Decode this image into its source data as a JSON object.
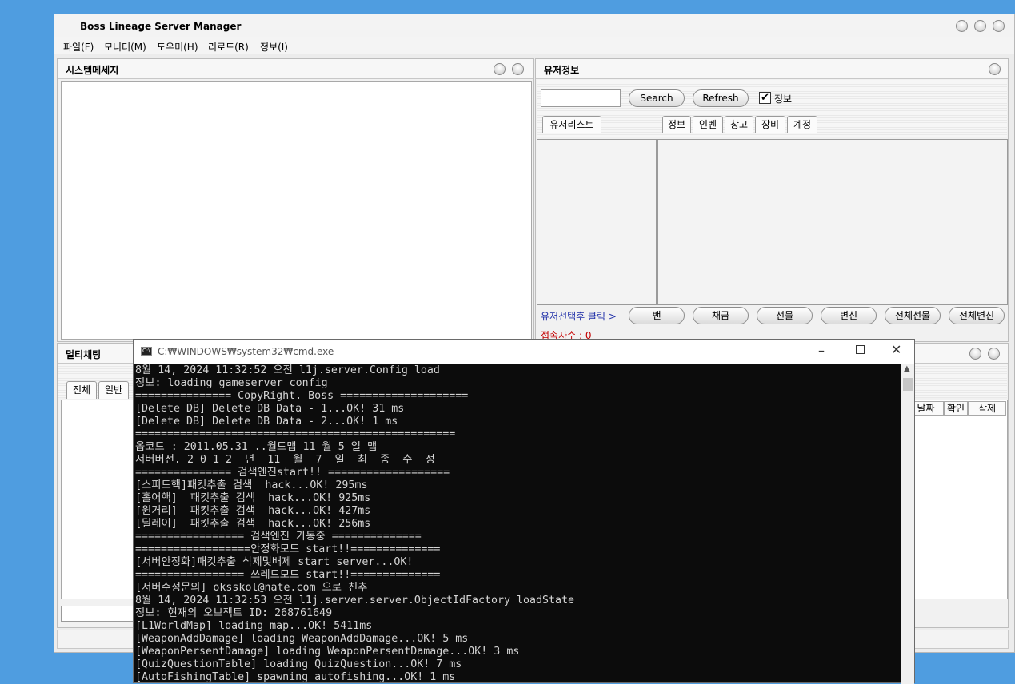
{
  "app": {
    "title": "Boss Lineage Server Manager",
    "menu": [
      "파일(F)",
      "모니터(M)",
      "도우미(H)",
      "리로드(R)",
      "정보(I)"
    ]
  },
  "system_panel": {
    "title": "시스템메세지"
  },
  "user_panel": {
    "title": "유저정보",
    "search_value": "",
    "search_label": "Search",
    "refresh_label": "Refresh",
    "info_checkbox_label": "정보",
    "info_checked": true,
    "list_tab": "유저리스트",
    "detail_tabs": [
      "정보",
      "인벤",
      "창고",
      "장비",
      "계정"
    ],
    "action_hint": "유저선택후 클릭 >",
    "actions": [
      "밴",
      "채금",
      "선물",
      "변신",
      "전체선물",
      "전체변신"
    ],
    "connections": "접속자수 : 0"
  },
  "chat_panel": {
    "title": "멀티채팅",
    "tabs": [
      "전체",
      "일반"
    ],
    "columns": [
      "날짜",
      "확인",
      "삭제"
    ],
    "input_value": ""
  },
  "console": {
    "title": "C:₩WINDOWS₩system32₩cmd.exe",
    "lines": [
      "8월 14, 2024 11:32:52 오전 l1j.server.Config load",
      "정보: loading gameserver config",
      "=============== CopyRight. Boss ====================",
      "[Delete DB] Delete DB Data - 1...OK! 31 ms",
      "[Delete DB] Delete DB Data - 2...OK! 1 ms",
      "==================================================",
      "옵코드 : 2011.05.31 ..월드맵 11 월 5 일 맵",
      "서버버전. 2 0 1 2  년  11  월  7  일  최  종  수  정",
      "=============== 검색엔진start!! ===================",
      "[스피드핵]패킷추출 검색  hack...OK! 295ms",
      "[홀어핵]  패킷추출 검색  hack...OK! 925ms",
      "[원거리]  패킷추출 검색  hack...OK! 427ms",
      "[딜레이]  패킷추출 검색  hack...OK! 256ms",
      "================= 검색엔진 가동중 ==============",
      "==================안정화모드 start!!==============",
      "[서버안정화]패킷추출 삭제및배제 start server...OK!",
      "================= 쓰레드모드 start!!==============",
      "[서버수정문의] oksskol@nate.com 으로 친추",
      "8월 14, 2024 11:32:53 오전 l1j.server.server.ObjectIdFactory loadState",
      "정보: 현재의 오브젝트 ID: 268761649",
      "[L1WorldMap] loading map...OK! 5411ms",
      "[WeaponAddDamage] loading WeaponAddDamage...OK! 5 ms",
      "[WeaponPersentDamage] loading WeaponPersentDamage...OK! 3 ms",
      "[QuizQuestionTable] loading QuizQuestion...OK! 7 ms",
      "[AutoFishingTable] spawning autofishing...OK! 1 ms"
    ]
  },
  "colors": {
    "desktop": "#4f9de0",
    "action_hint": "#1f2fa8",
    "connections": "#c40000",
    "console_bg": "#0c0c0c"
  }
}
